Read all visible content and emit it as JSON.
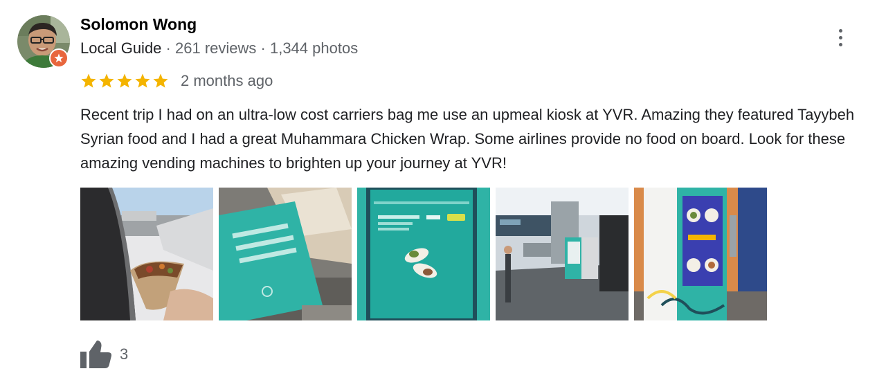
{
  "reviewer": {
    "name": "Solomon Wong",
    "badge": "Local Guide",
    "reviews": "261 reviews",
    "photos": "1,344 photos",
    "separator": "·",
    "avatar_icon": "profile-photo",
    "badge_icon": "local-guide-star-icon"
  },
  "rating": {
    "stars": 5,
    "max_stars": 5,
    "star_color": "#f4b400",
    "date": "2 months ago"
  },
  "review_text": "Recent trip I had on an ultra-low cost carriers bag me use an upmeal kiosk at YVR. Amazing they featured Tayybeh Syrian food and I had a great Muhammara Chicken Wrap. Some airlines provide no food on board. Look for these amazing vending machines to brighten up your journey at YVR!",
  "photos": [
    {
      "name": "photo-wrap-airplane-window"
    },
    {
      "name": "photo-wrap-package"
    },
    {
      "name": "photo-kiosk-screen"
    },
    {
      "name": "photo-airport-terminal"
    },
    {
      "name": "photo-vending-machine"
    }
  ],
  "helpful": {
    "icon": "thumbs-up-icon",
    "count": "3"
  },
  "menu_icon": "more-vert-icon",
  "colors": {
    "text_primary": "#202124",
    "text_secondary": "#5f6368",
    "badge_orange": "#e8663d",
    "kiosk_teal": "#2fb3a6"
  }
}
